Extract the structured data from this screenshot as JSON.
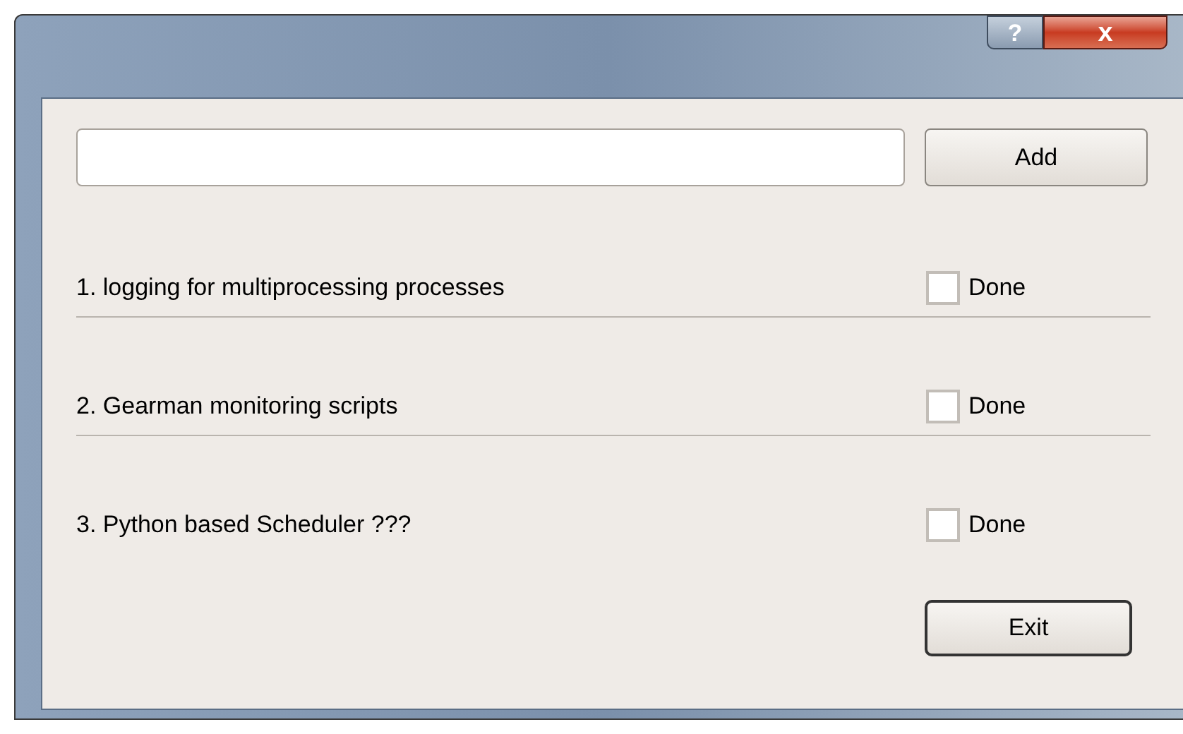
{
  "title_bar": {
    "buttons": [
      {
        "kind": "help",
        "label": "?"
      },
      {
        "kind": "close",
        "label": "x"
      }
    ]
  },
  "add_button": "Add",
  "tasks": [
    {
      "label": "1. logging for multiprocessing processes",
      "check_label": "Done",
      "checked": false
    },
    {
      "label": "2. Gearman monitoring scripts",
      "check_label": "Done",
      "checked": false
    },
    {
      "label": "3. Python based Scheduler ???",
      "check_label": "Done",
      "checked": false
    }
  ],
  "exit_button": "Exit"
}
